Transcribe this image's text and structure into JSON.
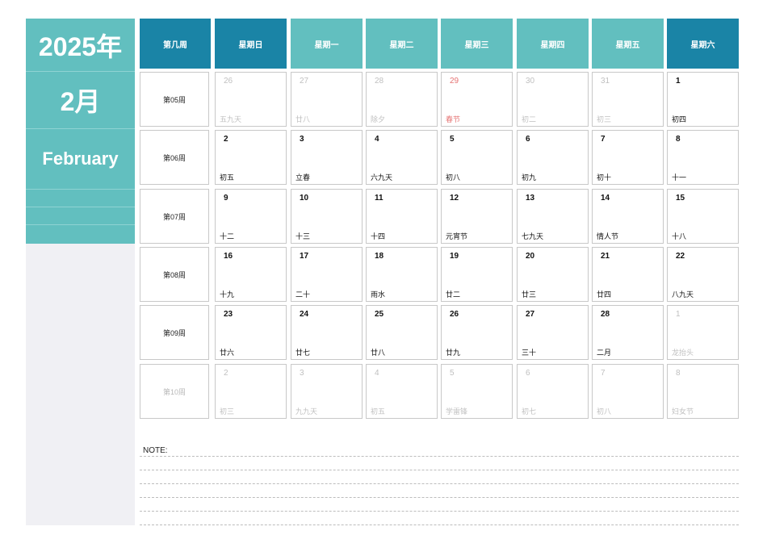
{
  "sidebar": {
    "year": "2025年",
    "month_cn": "2月",
    "month_en": "February"
  },
  "header": [
    "第几周",
    "星期日",
    "星期一",
    "星期二",
    "星期三",
    "星期四",
    "星期五",
    "星期六"
  ],
  "header_styles": [
    "dark",
    "dark",
    "light",
    "light",
    "light",
    "light",
    "light",
    "dark"
  ],
  "colors": {
    "dark_teal": "#1a84a6",
    "light_teal": "#62bfbf",
    "holiday_red": "#e57373",
    "dim_gray": "#c0c0c0"
  },
  "weeks": [
    {
      "label": "第05周",
      "dim": false,
      "days": [
        {
          "n": "26",
          "l": "五九天",
          "dim": true
        },
        {
          "n": "27",
          "l": "廿八",
          "dim": true
        },
        {
          "n": "28",
          "l": "除夕",
          "dim": true
        },
        {
          "n": "29",
          "l": "春节",
          "dim": true,
          "red": true
        },
        {
          "n": "30",
          "l": "初二",
          "dim": true
        },
        {
          "n": "31",
          "l": "初三",
          "dim": true
        },
        {
          "n": "1",
          "l": "初四"
        }
      ]
    },
    {
      "label": "第06周",
      "dim": false,
      "days": [
        {
          "n": "2",
          "l": "初五"
        },
        {
          "n": "3",
          "l": "立春"
        },
        {
          "n": "4",
          "l": "六九天"
        },
        {
          "n": "5",
          "l": "初八"
        },
        {
          "n": "6",
          "l": "初九"
        },
        {
          "n": "7",
          "l": "初十"
        },
        {
          "n": "8",
          "l": "十一"
        }
      ]
    },
    {
      "label": "第07周",
      "dim": false,
      "days": [
        {
          "n": "9",
          "l": "十二"
        },
        {
          "n": "10",
          "l": "十三"
        },
        {
          "n": "11",
          "l": "十四"
        },
        {
          "n": "12",
          "l": "元宵节"
        },
        {
          "n": "13",
          "l": "七九天"
        },
        {
          "n": "14",
          "l": "情人节"
        },
        {
          "n": "15",
          "l": "十八"
        }
      ]
    },
    {
      "label": "第08周",
      "dim": false,
      "days": [
        {
          "n": "16",
          "l": "十九"
        },
        {
          "n": "17",
          "l": "二十"
        },
        {
          "n": "18",
          "l": "雨水"
        },
        {
          "n": "19",
          "l": "廿二"
        },
        {
          "n": "20",
          "l": "廿三"
        },
        {
          "n": "21",
          "l": "廿四"
        },
        {
          "n": "22",
          "l": "八九天"
        }
      ]
    },
    {
      "label": "第09周",
      "dim": false,
      "days": [
        {
          "n": "23",
          "l": "廿六"
        },
        {
          "n": "24",
          "l": "廿七"
        },
        {
          "n": "25",
          "l": "廿八"
        },
        {
          "n": "26",
          "l": "廿九"
        },
        {
          "n": "27",
          "l": "三十"
        },
        {
          "n": "28",
          "l": "二月"
        },
        {
          "n": "1",
          "l": "龙抬头",
          "dim": true
        }
      ]
    },
    {
      "label": "第10周",
      "dim": true,
      "days": [
        {
          "n": "2",
          "l": "初三",
          "dim": true
        },
        {
          "n": "3",
          "l": "九九天",
          "dim": true
        },
        {
          "n": "4",
          "l": "初五",
          "dim": true
        },
        {
          "n": "5",
          "l": "学雷锋",
          "dim": true
        },
        {
          "n": "6",
          "l": "初七",
          "dim": true
        },
        {
          "n": "7",
          "l": "初八",
          "dim": true
        },
        {
          "n": "8",
          "l": "妇女节",
          "dim": true
        }
      ]
    }
  ],
  "notes": {
    "label": "NOTE:"
  }
}
